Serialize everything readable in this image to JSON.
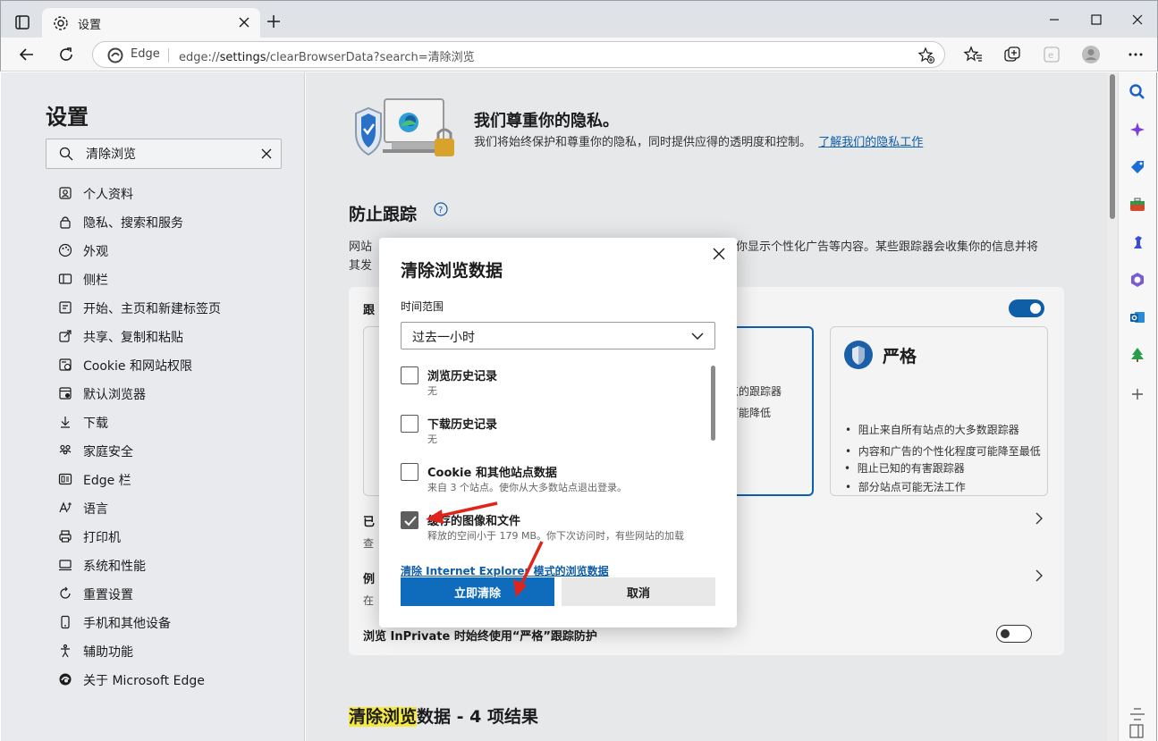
{
  "tab": {
    "title": "设置"
  },
  "address": {
    "site_label": "Edge",
    "url_prefix": "edge://",
    "url_main": "settings",
    "url_rest": "/clearBrowserData?search=清除浏览"
  },
  "sidebar": {
    "title": "设置",
    "search_value": "清除浏览",
    "items": [
      {
        "label": "个人资料",
        "icon": "profile-icon"
      },
      {
        "label": "隐私、搜索和服务",
        "icon": "lock-icon"
      },
      {
        "label": "外观",
        "icon": "palette-icon"
      },
      {
        "label": "侧栏",
        "icon": "sidebar-icon"
      },
      {
        "label": "开始、主页和新建标签页",
        "icon": "home-icon"
      },
      {
        "label": "共享、复制和粘贴",
        "icon": "share-icon"
      },
      {
        "label": "Cookie 和网站权限",
        "icon": "cookie-icon"
      },
      {
        "label": "默认浏览器",
        "icon": "browser-icon"
      },
      {
        "label": "下载",
        "icon": "download-icon"
      },
      {
        "label": "家庭安全",
        "icon": "family-icon"
      },
      {
        "label": "Edge 栏",
        "icon": "edge-bar-icon"
      },
      {
        "label": "语言",
        "icon": "language-icon"
      },
      {
        "label": "打印机",
        "icon": "printer-icon"
      },
      {
        "label": "系统和性能",
        "icon": "system-icon"
      },
      {
        "label": "重置设置",
        "icon": "reset-icon"
      },
      {
        "label": "手机和其他设备",
        "icon": "phone-icon"
      },
      {
        "label": "辅助功能",
        "icon": "accessibility-icon"
      },
      {
        "label": "关于 Microsoft Edge",
        "icon": "edge-logo-icon"
      }
    ]
  },
  "privacy": {
    "title": "我们尊重你的隐私。",
    "desc": "我们将始终保护和尊重你的隐私，同时提供应得的透明度和控制。",
    "link": "了解我们的隐私工作"
  },
  "tracking": {
    "title": "防止跟踪",
    "desc_left_1": "网站",
    "desc_right_1": "你显示个性化广告等内容。某些跟踪器会收集你的信息并将",
    "desc_left_2": "其发",
    "card_label": "跟",
    "balanced_bullets": [
      "站点的跟踪器",
      "度可能降低"
    ],
    "strict_title": "严格",
    "strict_bullets": [
      "阻止来自所有站点的大多数跟踪器",
      "内容和广告的个性化程度可能降至最低",
      "部分站点可能无法工作",
      "阻止已知的有害跟踪器"
    ],
    "row1_title": "已",
    "row1_sub": "查",
    "row2_title": "例",
    "row2_sub": "在",
    "inprivate_label": "浏览 InPrivate 时始终使用“严格”跟踪防护"
  },
  "results": {
    "highlight": "清除浏览",
    "rest": "数据 - 4 项结果"
  },
  "dialog": {
    "title": "清除浏览数据",
    "range_label": "时间范围",
    "range_value": "过去一小时",
    "options": [
      {
        "title": "浏览历史记录",
        "sub": "无",
        "checked": false
      },
      {
        "title": "下载历史记录",
        "sub": "无",
        "checked": false
      },
      {
        "title": "Cookie 和其他站点数据",
        "sub": "来自 3 个站点。使你从大多数站点退出登录。",
        "checked": false
      },
      {
        "title": "缓存的图像和文件",
        "sub": "释放的空间小于 179 MB。你下次访问时，有些网站的加载",
        "checked": true
      }
    ],
    "ie_link": "清除 Internet Explorer 模式的浏览数据",
    "clear_button": "立即清除",
    "cancel_button": "取消"
  },
  "colors": {
    "accent": "#0f6cbd",
    "link": "#0f5ea8",
    "highlight": "#f4e842",
    "arrow": "#e0231b"
  }
}
